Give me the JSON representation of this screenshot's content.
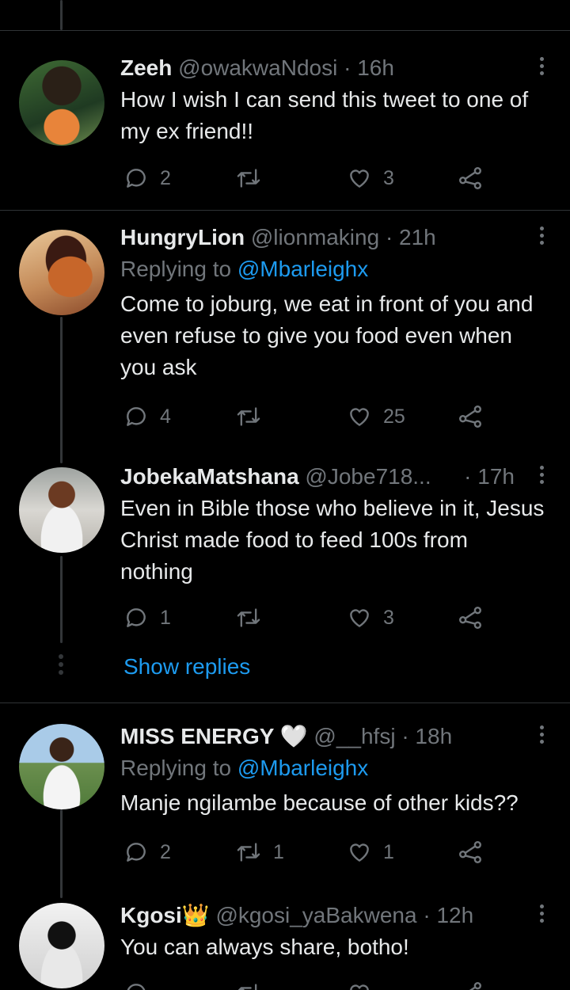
{
  "tweets": [
    {
      "name": "Zeeh",
      "handle": "@owakwaNdosi",
      "time": "· 16h",
      "reply_prefix": "",
      "reply_to": "",
      "text": "How I wish I can send this tweet to one of my ex friend!!",
      "replies": "2",
      "retweets": "",
      "likes": "3"
    },
    {
      "name": "HungryLion",
      "handle": "@lionmaking",
      "time": "· 21h",
      "reply_prefix": "Replying to ",
      "reply_to": "@Mbarleighx",
      "text": "Come to joburg, we eat in front of you and even refuse to give you food even when you ask",
      "replies": "4",
      "retweets": "",
      "likes": "25"
    },
    {
      "name": "JobekaMatshana",
      "handle": "@Jobe718...",
      "time": "· 17h",
      "reply_prefix": "",
      "reply_to": "",
      "text": "Even in Bible those who believe in it, Jesus Christ made food to feed 100s from nothing",
      "replies": "1",
      "retweets": "",
      "likes": "3"
    },
    {
      "name": "MISS ENERGY 🤍",
      "handle": "@__hfsj",
      "time": "· 18h",
      "reply_prefix": "Replying to ",
      "reply_to": "@Mbarleighx",
      "text": "Manje ngilambe because of other kids??",
      "replies": "2",
      "retweets": "1",
      "likes": "1"
    },
    {
      "name": "Kgosi👑",
      "handle": "@kgosi_yaBakwena",
      "time": "· 12h",
      "reply_prefix": "",
      "reply_to": "",
      "text": "You can always share, botho!",
      "replies": "",
      "retweets": "",
      "likes": ""
    }
  ],
  "show_replies_label": "Show replies",
  "colors": {
    "background": "#000000",
    "link": "#1d9bf0",
    "muted": "#71767b",
    "text": "#e7e9ea"
  },
  "icons": [
    "reply-icon",
    "retweet-icon",
    "like-icon",
    "share-icon",
    "more-icon"
  ]
}
